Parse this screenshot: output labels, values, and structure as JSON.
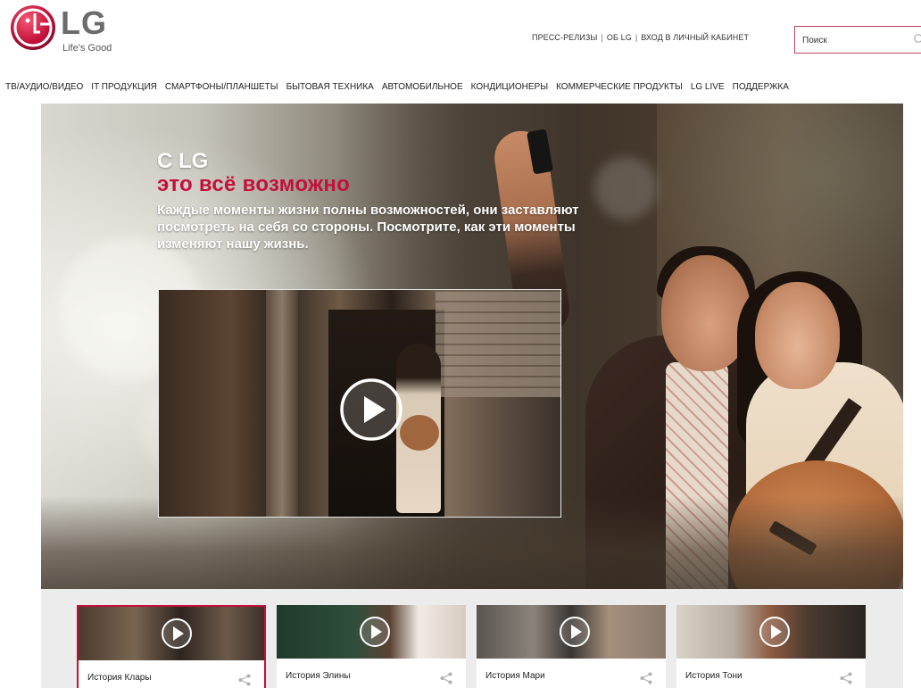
{
  "brand": {
    "logo_word": "LG",
    "tagline": "Life's Good",
    "accent_color": "#c4103a",
    "logo_icon": "lg-face-logo"
  },
  "top_links": {
    "items": [
      "ПРЕСС-РЕЛИЗЫ",
      "ОБ LG",
      "ВХОД В ЛИЧНЫЙ КАБИНЕТ"
    ],
    "separator": "|"
  },
  "search": {
    "placeholder": "Поиск",
    "icon": "search-icon"
  },
  "nav": {
    "items": [
      "ТВ/АУДИО/ВИДЕО",
      "IT ПРОДУКЦИЯ",
      "СМАРТФОНЫ/ПЛАНШЕТЫ",
      "БЫТОВАЯ ТЕХНИКА",
      "АВТОМОБИЛЬНОЕ",
      "КОНДИЦИОНЕРЫ",
      "КОММЕРЧЕСКИЕ ПРОДУКТЫ",
      "LG LIVE",
      "ПОДДЕРЖКА"
    ]
  },
  "hero": {
    "title_line1": "С LG",
    "title_line2": "это всё возможно",
    "description": "Каждые моменты жизни полны возможностей, они заставляют посмотреть на себя со стороны. Посмотрите, как эти моменты изменяют нашу жизнь.",
    "video_icon": "play-icon"
  },
  "stories": [
    {
      "label": "История Клары",
      "active": true
    },
    {
      "label": "История Элины",
      "active": false
    },
    {
      "label": "История Мари",
      "active": false
    },
    {
      "label": "История Тони",
      "active": false
    }
  ]
}
